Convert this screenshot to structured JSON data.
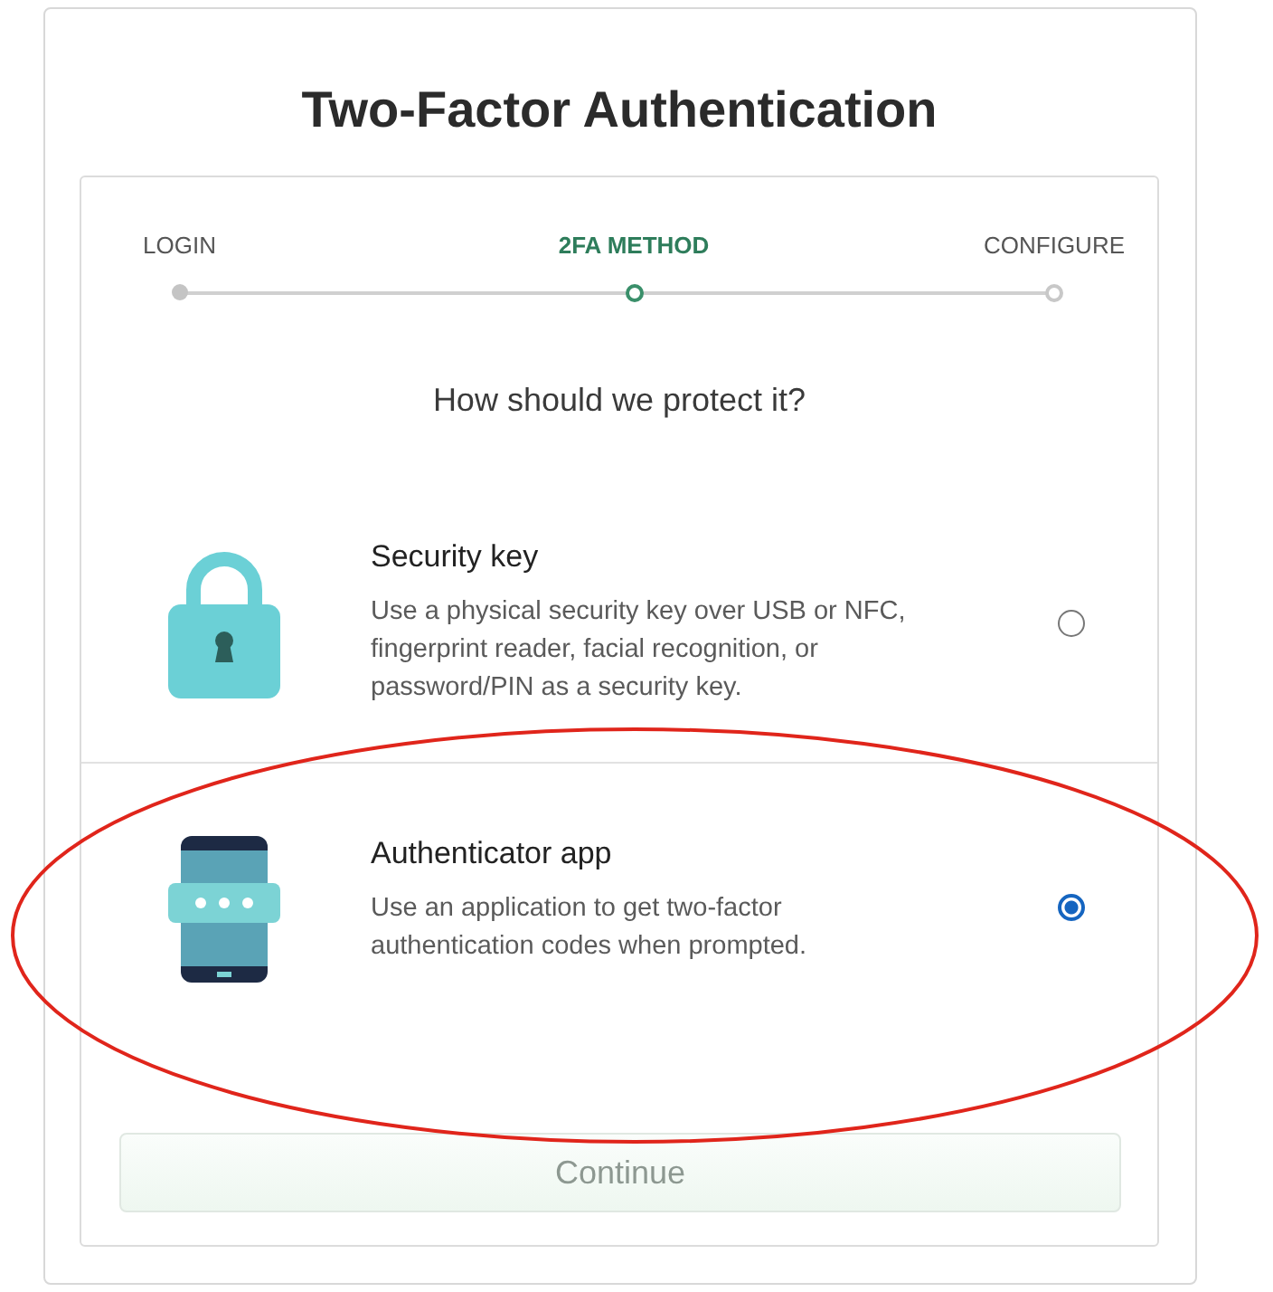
{
  "title": "Two-Factor Authentication",
  "steps": [
    {
      "label": "LOGIN",
      "kind": "done",
      "selected": false
    },
    {
      "label": "2FA METHOD",
      "kind": "current",
      "selected": true
    },
    {
      "label": "CONFIGURE",
      "kind": "upcoming",
      "selected": false
    }
  ],
  "question": "How should we protect it?",
  "options": [
    {
      "kind": "lock",
      "title": "Security key",
      "description": "Use a physical security key over USB or NFC, fingerprint reader, facial recognition, or password/PIN as a security key.",
      "selected": false
    },
    {
      "kind": "phone",
      "title": "Authenticator app",
      "description": "Use an application to get two-factor authentication codes when prompted.",
      "selected": true
    }
  ],
  "continue_button": {
    "label": "Continue",
    "disabled": true
  }
}
